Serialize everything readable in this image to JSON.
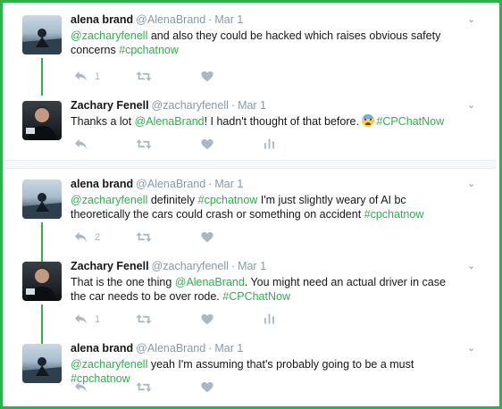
{
  "tweets": [
    {
      "name": "alena brand",
      "handle": "@AlenaBrand",
      "time": "Mar 1",
      "mention": "@zacharyfenell",
      "text": " and also they could be hacked which raises obvious safety concerns ",
      "hashtag": "#cpchatnow",
      "reply_count": "1",
      "retweet_count": "",
      "like_count": ""
    },
    {
      "name": "Zachary Fenell",
      "handle": "@zacharyfenell",
      "time": "Mar 1",
      "text_a": "Thanks a lot ",
      "mention": "@AlenaBrand",
      "text_b": "! I hadn't thought of that before. ",
      "hashtag": "#CPChatNow"
    },
    {
      "name": "alena brand",
      "handle": "@AlenaBrand",
      "time": "Mar 1",
      "mention": "@zacharyfenell",
      "text_a": " definitely ",
      "hashtag1": "#cpchatnow",
      "text_b": " I'm just slightly weary of AI bc theoretically the cars could crash or something on accident ",
      "hashtag2": "#cpchatnow",
      "reply_count": "2"
    },
    {
      "name": "Zachary Fenell",
      "handle": "@zacharyfenell",
      "time": "Mar 1",
      "text_a": "That is the one thing ",
      "mention": "@AlenaBrand",
      "text_b": ". You might need an actual driver in case the car needs to be over rode. ",
      "hashtag": "#CPChatNow",
      "reply_count": "1"
    },
    {
      "name": "alena brand",
      "handle": "@AlenaBrand",
      "time": "Mar 1",
      "mention": "@zacharyfenell",
      "text": " yeah I'm assuming that's probably going to be a must ",
      "hashtag": "#cpchatnow"
    }
  ],
  "separator": "·",
  "icons": {
    "reply": "reply-icon",
    "retweet": "retweet-icon",
    "like": "heart-icon",
    "analytics": "analytics-icon",
    "more": "chevron-down-icon"
  },
  "colors": {
    "accent": "#2bb24c",
    "muted": "#8899a6",
    "icon": "#aab8c2"
  }
}
